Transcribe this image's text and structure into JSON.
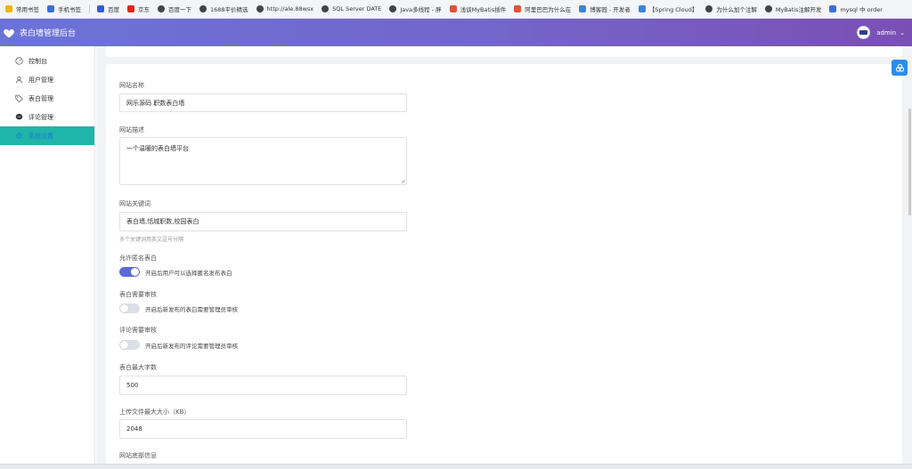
{
  "bookmarks": [
    {
      "label": "常用书签",
      "icon": "star-icon",
      "color": "#f5b400"
    },
    {
      "label": "手机书签",
      "icon": "phone-icon",
      "color": "#3b6fd8"
    },
    {
      "label": "百度",
      "icon": "baidu-icon",
      "color": "#2f5de0"
    },
    {
      "label": "京东",
      "icon": "jd-icon",
      "color": "#e1251b"
    },
    {
      "label": "百度一下",
      "icon": "globe-icon",
      "color": "#444444"
    },
    {
      "label": "1688平价精选",
      "icon": "globe-icon",
      "color": "#444444"
    },
    {
      "label": "http://ale.88wsx",
      "icon": "globe-icon",
      "color": "#444444"
    },
    {
      "label": "SQL Server DATE",
      "icon": "globe-icon",
      "color": "#444444"
    },
    {
      "label": "Java多线程 - 胖",
      "icon": "globe-icon",
      "color": "#444444"
    },
    {
      "label": "浅谈MyBatis插件",
      "icon": "csdn-icon",
      "color": "#e0533a"
    },
    {
      "label": "阿里巴巴为什么在",
      "icon": "csdn-icon",
      "color": "#e0533a"
    },
    {
      "label": "博客园 - 开发者",
      "icon": "cnblogs-icon",
      "color": "#3b84d8"
    },
    {
      "label": "【Spring Cloud】",
      "icon": "cnblogs-icon",
      "color": "#3b84d8"
    },
    {
      "label": "为什么加个注解",
      "icon": "globe-icon",
      "color": "#444444"
    },
    {
      "label": "MyBatis注解开发",
      "icon": "globe-icon",
      "color": "#444444"
    },
    {
      "label": "mysql 中 order",
      "icon": "paw-icon",
      "color": "#3b6fd8"
    }
  ],
  "header": {
    "title": "表白墙管理后台",
    "user": "admin",
    "avatar_text": "NEW"
  },
  "sidebar": {
    "items": [
      {
        "label": "控制台",
        "icon": "dashboard-icon"
      },
      {
        "label": "用户管理",
        "icon": "user-icon"
      },
      {
        "label": "表白管理",
        "icon": "tag-icon"
      },
      {
        "label": "评论管理",
        "icon": "comment-icon"
      },
      {
        "label": "系统设置",
        "icon": "settings-icon",
        "active": true
      }
    ]
  },
  "form": {
    "site_name": {
      "label": "网站名称",
      "value": "网乐源码 职数表白墙"
    },
    "site_desc": {
      "label": "网站描述",
      "value": "一个温暖的表白墙平台"
    },
    "site_keywords": {
      "label": "网站关键词",
      "value": "表白墙,恬城职数,校园表白",
      "hint": "多个关键词用英文逗号分隔"
    },
    "allow_anonymous": {
      "label": "允许匿名表白",
      "desc": "开启后用户可以选择匿名发布表白",
      "enabled": true
    },
    "confession_review": {
      "label": "表白需要审核",
      "desc": "开启后新发布的表白需要管理员审核",
      "enabled": false
    },
    "comment_review": {
      "label": "评论需要审核",
      "desc": "开启后新发布的评论需要管理员审核",
      "enabled": false
    },
    "max_length": {
      "label": "表白最大字数",
      "value": "500"
    },
    "max_upload": {
      "label": "上传文件最大大小（KB）",
      "value": "2048"
    },
    "icp": {
      "label": "网站底部信息"
    }
  },
  "colors": {
    "header_start": "#6b73d8",
    "header_end": "#7a4fb3",
    "active_menu": "#1fb5a9",
    "switch_on": "#5b6bd6"
  }
}
